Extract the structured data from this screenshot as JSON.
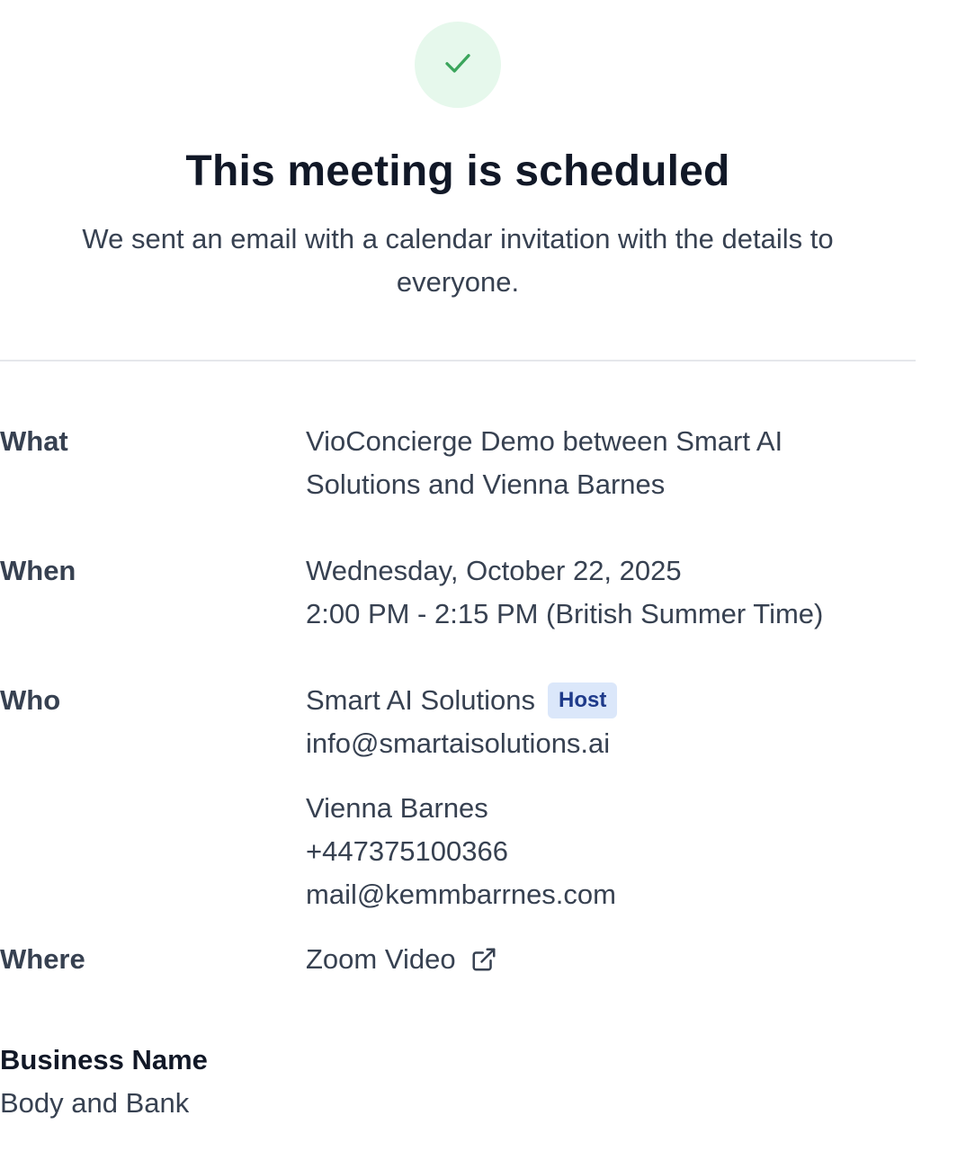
{
  "header": {
    "check_icon": "check-icon",
    "title": "This meeting is scheduled",
    "subtitle": "We sent an email with a calendar invitation with the details to everyone."
  },
  "details": {
    "what": {
      "label": "What",
      "value": "VioConcierge Demo between Smart AI Solutions and Vienna Barnes"
    },
    "when": {
      "label": "When",
      "date": "Wednesday, October 22, 2025",
      "time": "2:00 PM - 2:15 PM (British Summer Time)"
    },
    "who": {
      "label": "Who",
      "host": {
        "name": "Smart AI Solutions",
        "badge": "Host",
        "email": "info@smartaisolutions.ai"
      },
      "attendee": {
        "name": "Vienna Barnes",
        "phone": "+447375100366",
        "email": "mail@kemmbarrnes.com"
      }
    },
    "where": {
      "label": "Where",
      "value": "Zoom Video",
      "icon": "external-link-icon"
    }
  },
  "business": {
    "label": "Business Name",
    "value": "Body and Bank"
  },
  "colors": {
    "success_bg": "#e6f8ec",
    "success_check": "#3ba55c",
    "badge_bg": "#dbe7fa",
    "badge_text": "#1e3a8a"
  }
}
